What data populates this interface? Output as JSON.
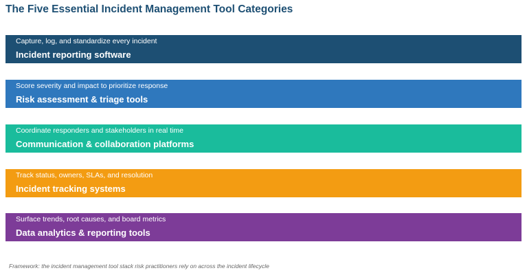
{
  "title": "The Five Essential Incident Management Tool Categories",
  "categories": [
    {
      "subtitle": "Capture, log, and standardize every incident",
      "name": "Incident reporting software",
      "color": "#1d4f73"
    },
    {
      "subtitle": "Score severity and impact to prioritize response",
      "name": "Risk assessment & triage tools",
      "color": "#2f78bd"
    },
    {
      "subtitle": "Coordinate responders and stakeholders in real time",
      "name": "Communication & collaboration platforms",
      "color": "#1abc9c"
    },
    {
      "subtitle": "Track status, owners, SLAs, and resolution",
      "name": "Incident tracking systems",
      "color": "#f39c12"
    },
    {
      "subtitle": "Surface trends, root causes, and board metrics",
      "name": "Data analytics & reporting tools",
      "color": "#7d3c98"
    }
  ],
  "footnote": "Framework: the incident management tool stack risk practitioners rely on across the incident lifecycle"
}
